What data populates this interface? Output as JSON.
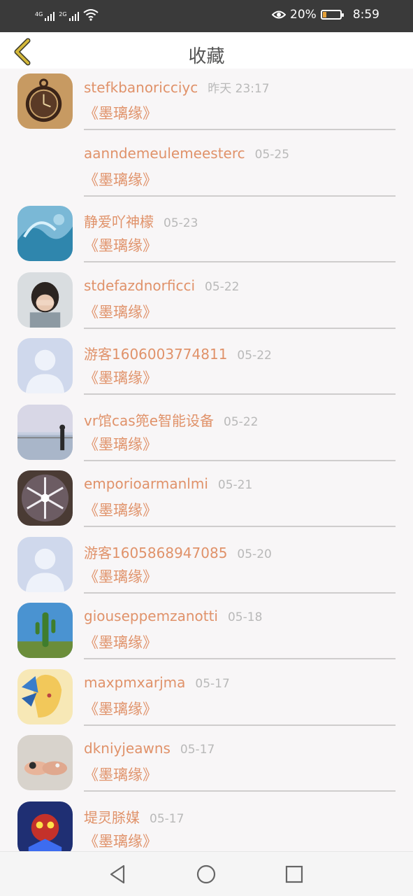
{
  "status_bar": {
    "signal1_label": "4G",
    "signal2_label": "2G",
    "battery_percent": "20%",
    "battery_level": 0.2,
    "time": "8:59"
  },
  "header": {
    "title": "收藏"
  },
  "items": [
    {
      "name": "stefkbanoricciyc",
      "time": "昨天 23:17",
      "book": "《墨璃缘》",
      "avatar": "pocket-watch"
    },
    {
      "name": "aanndemeulemeesterc",
      "time": "05-25",
      "book": "《墨璃缘》",
      "avatar": "none"
    },
    {
      "name": "静爱吖神檬",
      "time": "05-23",
      "book": "《墨璃缘》",
      "avatar": "ocean-wave"
    },
    {
      "name": "stdefazdnorficci",
      "time": "05-22",
      "book": "《墨璃缘》",
      "avatar": "girl-covering-face"
    },
    {
      "name": "游客1606003774811",
      "time": "05-22",
      "book": "《墨璃缘》",
      "avatar": "default-user"
    },
    {
      "name": "vr馆cas篼e智能设备",
      "time": "05-22",
      "book": "《墨璃缘》",
      "avatar": "seaside-figure"
    },
    {
      "name": "emporioarmanlmi",
      "time": "05-21",
      "book": "《墨璃缘》",
      "avatar": "snowflake"
    },
    {
      "name": "游客1605868947085",
      "time": "05-20",
      "book": "《墨璃缘》",
      "avatar": "default-user"
    },
    {
      "name": "giouseppemzanotti",
      "time": "05-18",
      "book": "《墨璃缘》",
      "avatar": "cactus"
    },
    {
      "name": "maxpmxarjma",
      "time": "05-17",
      "book": "《墨璃缘》",
      "avatar": "butterfly-anime"
    },
    {
      "name": "dkniyjeawns",
      "time": "05-17",
      "book": "《墨璃缘》",
      "avatar": "hands-rings"
    },
    {
      "name": "堤灵脎媒",
      "time": "05-17",
      "book": "《墨璃缘》",
      "avatar": "game-hero"
    }
  ],
  "nav": {
    "back": "back-triangle-icon",
    "home": "home-circle-icon",
    "recent": "recent-square-icon"
  },
  "colors": {
    "accent": "#e0926a",
    "status_bar": "#3a3a3a",
    "back_arrow": "#d4b83a"
  }
}
